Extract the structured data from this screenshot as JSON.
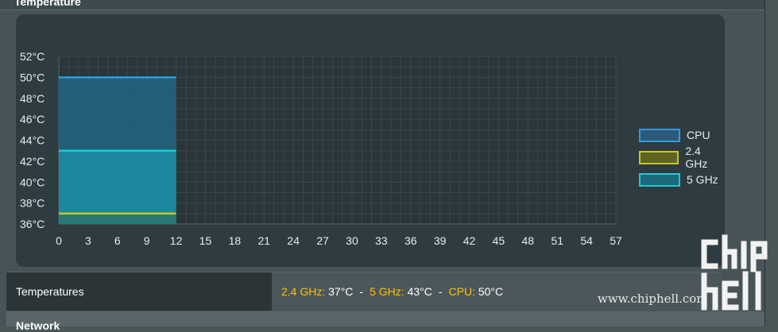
{
  "header": {
    "title": "Temperature"
  },
  "chart_data": {
    "type": "area",
    "x_ticks": [
      0,
      3,
      6,
      9,
      12,
      15,
      18,
      21,
      24,
      27,
      30,
      33,
      36,
      39,
      42,
      45,
      48,
      51,
      54,
      57
    ],
    "xlim": [
      0,
      57
    ],
    "y_ticks": [
      "52°C",
      "50°C",
      "48°C",
      "46°C",
      "44°C",
      "42°C",
      "40°C",
      "38°C",
      "36°C"
    ],
    "ylim": [
      36,
      52
    ],
    "grid": true,
    "legend_position": "right",
    "series": [
      {
        "name": "CPU",
        "color": "#2f9be0",
        "x": [
          0,
          12
        ],
        "values": [
          50,
          50
        ]
      },
      {
        "name": "5 GHz",
        "color": "#22c8d8",
        "x": [
          0,
          12
        ],
        "values": [
          43,
          43
        ]
      },
      {
        "name": "2.4 GHz",
        "color": "#c9c728",
        "x": [
          0,
          12
        ],
        "values": [
          37,
          37
        ]
      }
    ],
    "legend": [
      {
        "name": "CPU",
        "color": "#2f9be0",
        "fill": "#2d5a7a"
      },
      {
        "name": "2.4 GHz",
        "color": "#c9c728",
        "fill": "#5f6420"
      },
      {
        "name": "5 GHz",
        "color": "#22c8d8",
        "fill": "#1c6a7c"
      }
    ]
  },
  "temperatures": {
    "label": "Temperatures",
    "ghz24_key": "2.4 GHz:",
    "ghz24_val": "37°C",
    "ghz5_key": "5 GHz:",
    "ghz5_val": "43°C",
    "cpu_key": "CPU:",
    "cpu_val": "50°C",
    "separator": "-"
  },
  "network": {
    "title": "Network"
  },
  "watermark": {
    "text": "www.chiphell.com",
    "logo": "chip hell"
  }
}
